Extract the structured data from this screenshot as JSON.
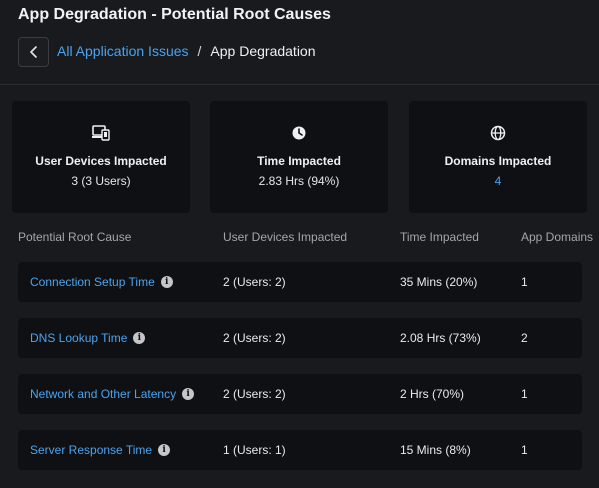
{
  "header": {
    "title": "App Degradation - Potential Root Causes"
  },
  "breadcrumb": {
    "back_icon": "chevron-left-icon",
    "parent": "All Application Issues",
    "separator": "/",
    "current": "App Degradation"
  },
  "summary": {
    "devices": {
      "icon": "devices-icon",
      "label": "User Devices Impacted",
      "value": "3 (3 Users)"
    },
    "time": {
      "icon": "clock-icon",
      "label": "Time Impacted",
      "value": "2.83 Hrs (94%)"
    },
    "domains": {
      "icon": "globe-icon",
      "label": "Domains Impacted",
      "value": "4"
    }
  },
  "table": {
    "columns": [
      "Potential Root Cause",
      "User Devices Impacted",
      "Time Impacted",
      "App Domains"
    ],
    "rows": [
      {
        "cause": "Connection Setup Time",
        "devices": "2 (Users: 2)",
        "time": "35 Mins (20%)",
        "domains": "1"
      },
      {
        "cause": "DNS Lookup Time",
        "devices": "2 (Users: 2)",
        "time": "2.08 Hrs (73%)",
        "domains": "2"
      },
      {
        "cause": "Network and Other Latency",
        "devices": "2 (Users: 2)",
        "time": "2 Hrs (70%)",
        "domains": "1"
      },
      {
        "cause": "Server Response Time",
        "devices": "1 (Users: 1)",
        "time": "15 Mins (8%)",
        "domains": "1"
      }
    ]
  },
  "colors": {
    "accent": "#4aa3f0",
    "background": "#191a1e",
    "card": "#0f1013"
  }
}
